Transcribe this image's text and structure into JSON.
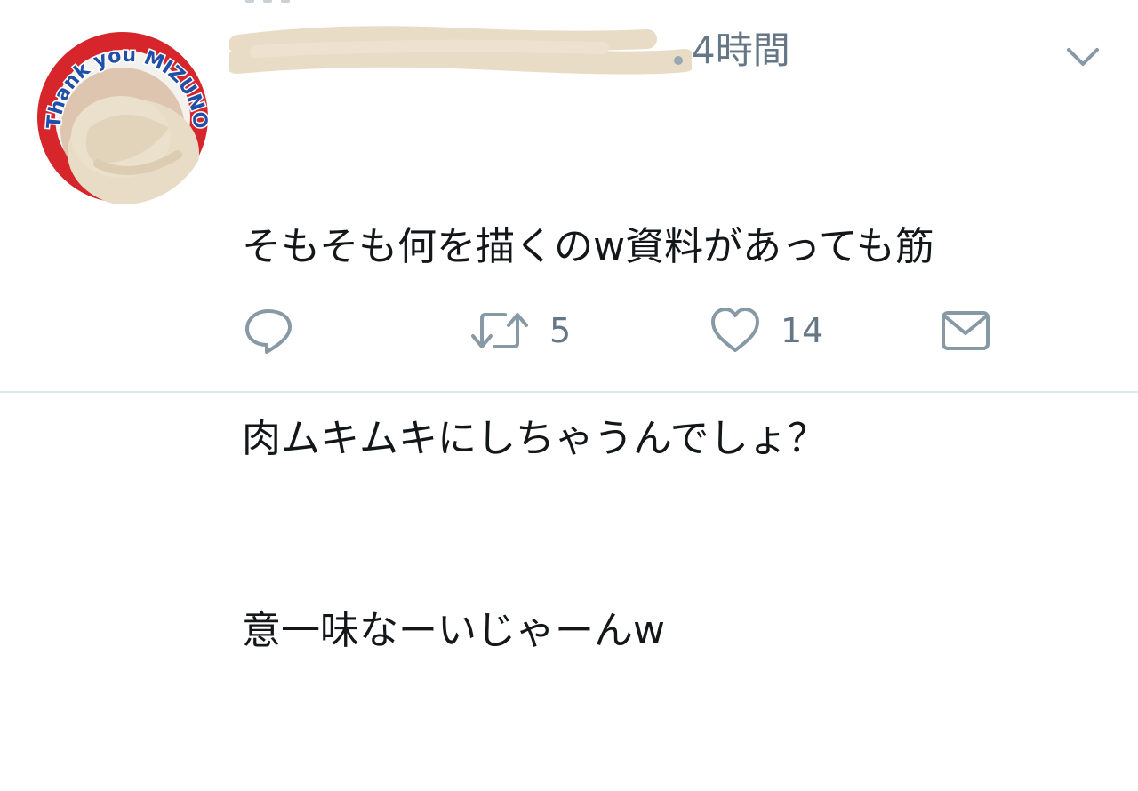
{
  "tweet": {
    "timestamp": "4時間",
    "text_lines": [
      "そもそも何を描くのw資料があっても筋",
      "肉ムキムキにしちゃうんでしょ？",
      "意一味なーいじゃーんw"
    ],
    "avatar_text": "Thank you MIZUNO",
    "actions": {
      "reply_icon": "reply-icon",
      "retweet_icon": "retweet-icon",
      "retweet_count": "5",
      "like_icon": "heart-icon",
      "like_count": "14",
      "dm_icon": "envelope-icon"
    },
    "menu_icon": "chevron-down-icon"
  },
  "colors": {
    "text": "#14171a",
    "secondary": "#657786",
    "divider": "#e1e8ed",
    "redaction": "#e8dcc6",
    "avatar_blue": "#1f4fa8",
    "avatar_red": "#d6262b"
  }
}
